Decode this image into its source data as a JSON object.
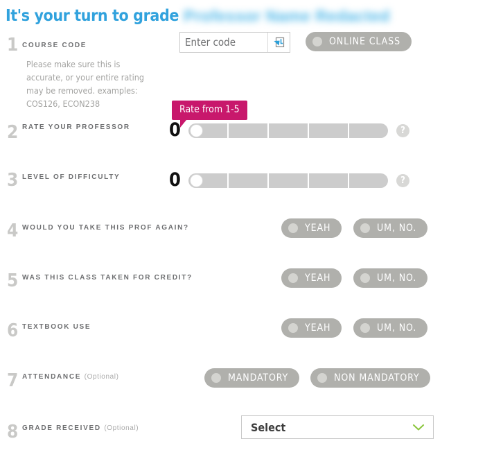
{
  "header": {
    "title": "It's your turn to grade",
    "professor_name": "Professor Name Redacted"
  },
  "questions": [
    {
      "number": "1",
      "label": "COURSE CODE",
      "optional": "",
      "input_placeholder": "Enter code",
      "input_value": "",
      "input_icon": "arrow-into-box-icon",
      "hint": "Please make sure this is accurate, or your entire rating may be removed. examples: COS126, ECON238",
      "online_class_label": "ONLINE CLASS"
    },
    {
      "number": "2",
      "label": "RATE YOUR PROFESSOR",
      "optional": "",
      "value": "0",
      "segments": 5,
      "tooltip": "Rate from 1-5",
      "help_icon": "question-mark-icon"
    },
    {
      "number": "3",
      "label": "LEVEL OF DIFFICULTY",
      "optional": "",
      "value": "0",
      "segments": 5,
      "help_icon": "question-mark-icon"
    },
    {
      "number": "4",
      "label": "WOULD YOU TAKE THIS PROF AGAIN?",
      "optional": "",
      "yes_label": "YEAH",
      "no_label": "UM, NO."
    },
    {
      "number": "5",
      "label": "WAS THIS CLASS TAKEN FOR CREDIT?",
      "optional": "",
      "yes_label": "YEAH",
      "no_label": "UM, NO."
    },
    {
      "number": "6",
      "label": "TEXTBOOK USE",
      "optional": "",
      "yes_label": "YEAH",
      "no_label": "UM, NO."
    },
    {
      "number": "7",
      "label": "ATTENDANCE",
      "optional": "(Optional)",
      "yes_label": "MANDATORY",
      "no_label": "NON MANDATORY"
    },
    {
      "number": "8",
      "label": "GRADE RECEIVED",
      "optional": "(Optional)",
      "select_value": "Select",
      "select_icon": "chevron-down-icon"
    }
  ],
  "colors": {
    "title_blue": "#31a2dd",
    "tooltip_magenta": "#c8186c",
    "pill_gray": "#b0b0ac",
    "slider_gray": "#cccccc",
    "chevron_green": "#8cc63f",
    "number_gray": "#c9c9c7",
    "label_gray": "#6d6e70"
  }
}
